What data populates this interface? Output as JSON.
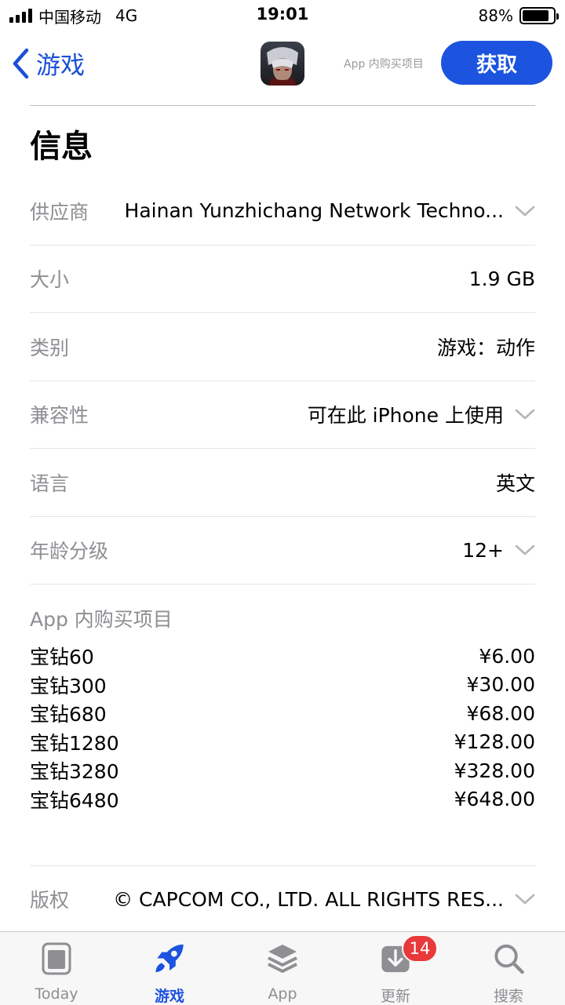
{
  "status_bar": {
    "carrier": "中国移动",
    "network": "4G",
    "time": "19:01",
    "battery_text": "88%",
    "battery_level": 0.88
  },
  "nav": {
    "back_label": "游戏",
    "iap_label": "App 内购买项目",
    "get_label": "获取"
  },
  "section_title": "信息",
  "info_rows": [
    {
      "label": "供应商",
      "value": "Hainan Yunzhichang Network Techno...",
      "chevron": true
    },
    {
      "label": "大小",
      "value": "1.9 GB",
      "chevron": false
    },
    {
      "label": "类别",
      "value": "游戏：动作",
      "chevron": false
    },
    {
      "label": "兼容性",
      "value": "可在此 iPhone 上使用",
      "chevron": true
    },
    {
      "label": "语言",
      "value": "英文",
      "chevron": false
    },
    {
      "label": "年龄分级",
      "value": "12+",
      "chevron": true
    }
  ],
  "iap": {
    "title": "App 内购买项目",
    "items": [
      {
        "name": "宝钻60",
        "price": "¥6.00"
      },
      {
        "name": "宝钻300",
        "price": "¥30.00"
      },
      {
        "name": "宝钻680",
        "price": "¥68.00"
      },
      {
        "name": "宝钻1280",
        "price": "¥128.00"
      },
      {
        "name": "宝钻3280",
        "price": "¥328.00"
      },
      {
        "name": "宝钻6480",
        "price": "¥648.00"
      }
    ]
  },
  "copyright": {
    "label": "版权",
    "value": "© CAPCOM CO., LTD. ALL RIGHTS RES..."
  },
  "tabbar": {
    "tabs": [
      {
        "label": "Today",
        "icon": "today-icon",
        "active": false
      },
      {
        "label": "游戏",
        "icon": "rocket-icon",
        "active": true
      },
      {
        "label": "App",
        "icon": "layers-icon",
        "active": false
      },
      {
        "label": "更新",
        "icon": "download-icon",
        "active": false
      },
      {
        "label": "搜索",
        "icon": "search-icon",
        "active": false
      }
    ],
    "updates_badge": "14"
  },
  "colors": {
    "accent": "#1c53df",
    "badge": "#e9393a",
    "secondary_text": "#8e8e93"
  }
}
